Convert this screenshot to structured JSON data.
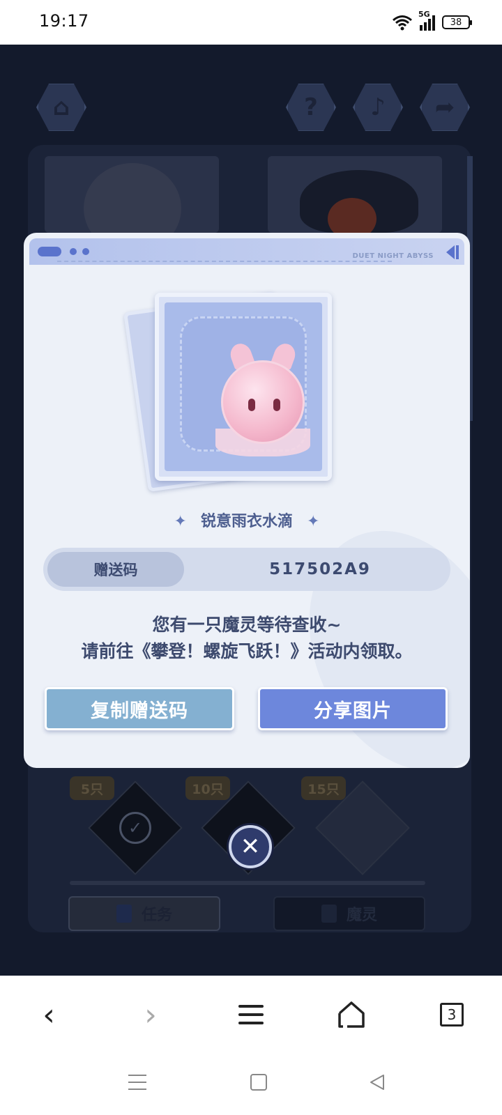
{
  "status_bar": {
    "time": "19:17",
    "network": "5G",
    "battery": "38"
  },
  "game": {
    "top_buttons": [
      "home-icon",
      "help-icon",
      "music-icon",
      "share-icon"
    ],
    "milestones": [
      {
        "label": "5只"
      },
      {
        "label": "10只"
      },
      {
        "label": "15只"
      }
    ],
    "tabs": {
      "task": "任务",
      "spirit": "魔灵"
    }
  },
  "modal": {
    "header_brand": "DUET NIGHT ABYSS",
    "item_name": "锐意雨衣水滴",
    "code_label": "赠送码",
    "code_value": "517502A9",
    "notice_line1": "您有一只魔灵等待查收~",
    "notice_line2": "请前往《攀登！螺旋飞跃！》活动内领取。",
    "copy_button": "复制赠送码",
    "share_button": "分享图片",
    "close_icon": "close-icon"
  },
  "browser_bar": {
    "tab_count": "3"
  },
  "colors": {
    "modal_bg": "#edf1f8",
    "primary_button": "#6d87dc",
    "secondary_button": "#84b0d1",
    "text_dark": "#3d4a6e"
  }
}
